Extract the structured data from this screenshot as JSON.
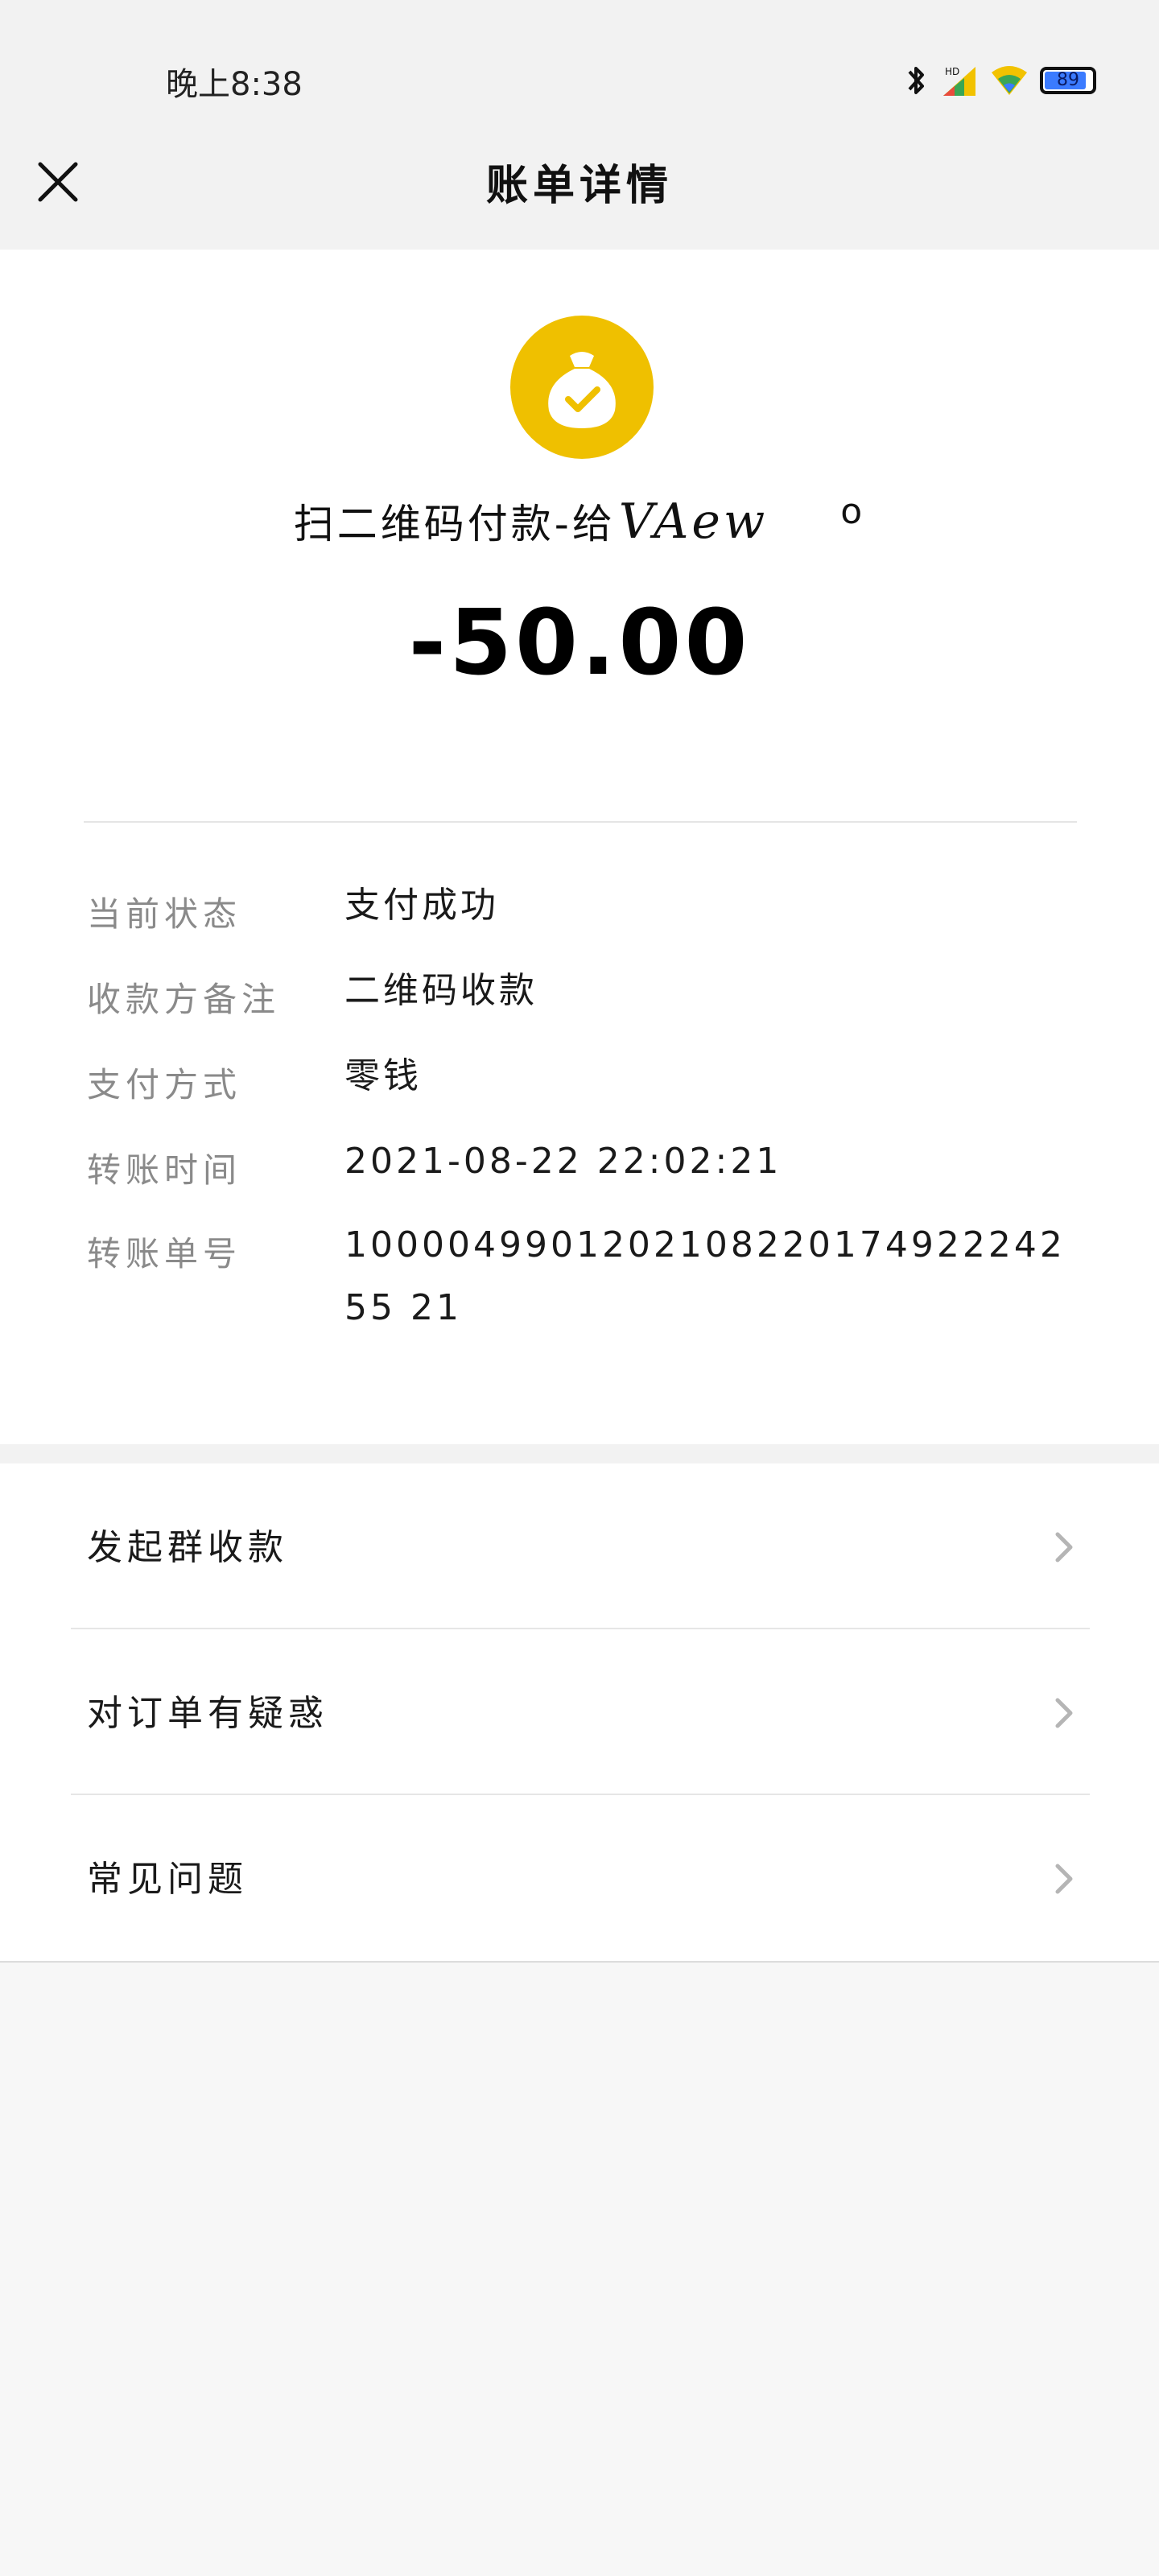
{
  "status_bar": {
    "time": "晚上8:38",
    "battery_level": 89,
    "battery_text": "89",
    "icons": [
      "bluetooth-icon",
      "signal-icon",
      "wifi-icon",
      "battery-icon"
    ]
  },
  "nav": {
    "title": "账单详情",
    "close_icon": "close-icon"
  },
  "summary": {
    "icon": "money-bag-check-icon",
    "icon_color": "#EFC000",
    "merchant_prefix": "扫二维码付款-给",
    "merchant_name": "VAew",
    "merchant_suffix": "o",
    "amount": "-50.00"
  },
  "details": [
    {
      "label": "当前状态",
      "value": "支付成功"
    },
    {
      "label": "收款方备注",
      "value": "二维码收款"
    },
    {
      "label": "支付方式",
      "value": "零钱"
    },
    {
      "label": "转账时间",
      "value": "2021-08-22 22:02:21"
    },
    {
      "label": "转账单号",
      "value": "100004990120210822017492224255 21"
    }
  ],
  "actions": [
    {
      "label": "发起群收款"
    },
    {
      "label": "对订单有疑惑"
    },
    {
      "label": "常见问题"
    }
  ],
  "colors": {
    "header_bg": "#F2F2F2",
    "card_bg": "#FFFFFF",
    "label_gray": "#8A8A8A",
    "accent_yellow": "#EFC000"
  }
}
